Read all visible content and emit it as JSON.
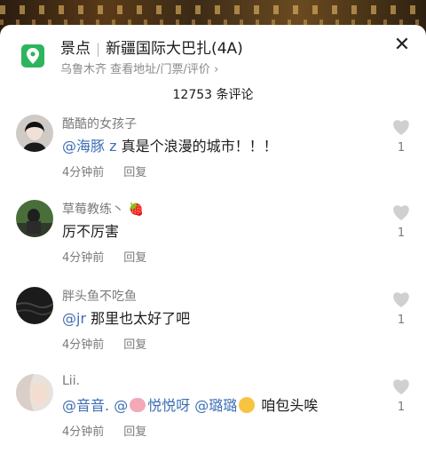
{
  "sheet": {
    "category": "景点",
    "title": "新疆国际大巴扎(4A)",
    "location": "乌鲁木齐",
    "details_link": "查看地址/门票/评价",
    "close_icon": "close-icon"
  },
  "comment_count": "12753 条评论",
  "comments": [
    {
      "username": "酷酷的女孩子",
      "mention": "@海豚 z",
      "text": " 真是个浪漫的城市！！！",
      "time": "4分钟前",
      "reply": "回复",
      "likes": "1"
    },
    {
      "username": "草莓教练丶",
      "text": "厉不厉害",
      "time": "4分钟前",
      "reply": "回复",
      "likes": "1"
    },
    {
      "username": "胖头鱼不吃鱼",
      "mention": "@jr",
      "text": " 那里也太好了吧",
      "time": "4分钟前",
      "reply": "回复",
      "likes": "1"
    },
    {
      "username": "Lii.",
      "mention1": "@音音.",
      "mention2": "@",
      "mention2b": "悦悦呀",
      "mention3": "@璐璐",
      "text": " 咱包头唉",
      "time": "4分钟前",
      "reply": "回复",
      "likes": "1"
    }
  ],
  "colors": {
    "accent_green": "#2db55d",
    "mention_blue": "#3d6fb4",
    "heart_gray": "#d0d0d0"
  }
}
